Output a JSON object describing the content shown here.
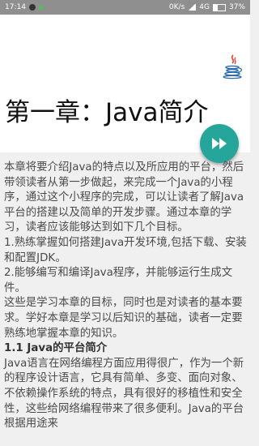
{
  "status_bar": {
    "time": "17:14",
    "network_speed": "0K/s",
    "network_type": "4G",
    "battery": "37%"
  },
  "chapter": {
    "title": "第一章：Java简介"
  },
  "content": {
    "intro": "本章将要介绍Java的特点以及所应用的平台，然后带领读者从第一步做起，来完成一个Java的小程序，通过这个小程序的完成，可以让读者了解Java平台的搭建以及简单的开发步骤。通过本章的学习，读者应该能够达到如下几个目标。",
    "goal_1": "1.熟练掌握如何搭建Java开发环境,包括下载、安装和配置JDK。",
    "goal_2": "2.能够编写和编译Java程序，并能够运行生成文件。",
    "summary": "这些是学习本章的目标，同时也是对读者的基本要求。学好本章是学习以后知识的基础，读者一定要熟练地掌握本章的知识。",
    "section_heading": "1.1 Java的平台简介",
    "section_body": "Java语言在网络编程方面应用得很广，作为一个新的程序设计语言，它具有简单、多变、面向对象、不依赖操作系统的特点，具有很好的移植性和安全性，这些给网络编程带来了很多便利。Java的平台根据用途来"
  }
}
